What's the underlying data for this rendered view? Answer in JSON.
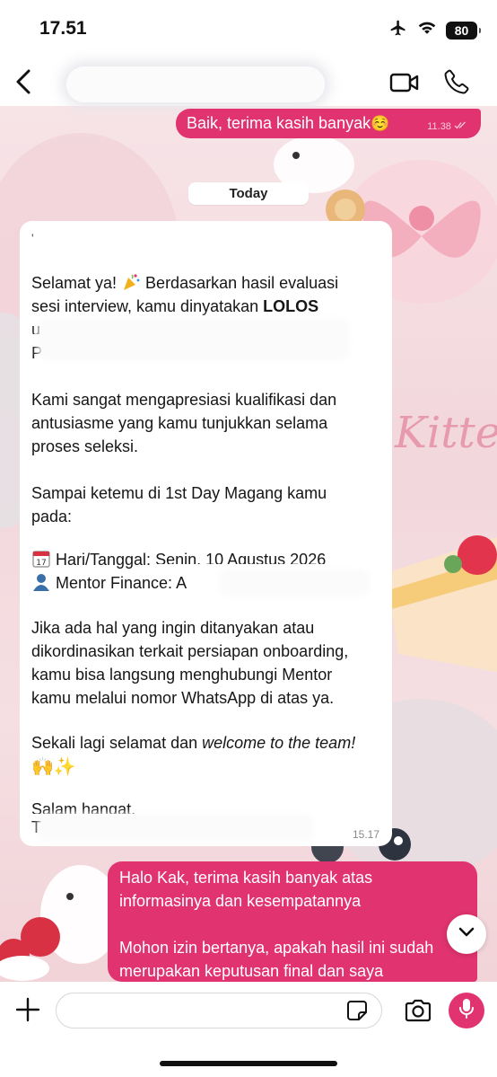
{
  "status_bar": {
    "time": "17.51",
    "battery": "80",
    "icons": [
      "airplane-icon",
      "wifi-icon",
      "battery-icon"
    ]
  },
  "header": {
    "icons": [
      "back-chevron-icon",
      "video-camera-icon",
      "phone-icon"
    ]
  },
  "messages": {
    "outgoing_top": {
      "text": "Baik, terima kasih banyak",
      "emoji": "☺️",
      "time": "11.38",
      "status": "read-ticks-icon"
    },
    "date_separator": "Today",
    "incoming": {
      "time": "15.17",
      "lines": {
        "l1a": "Selamat ya! ",
        "l1b": " Berdasarkan hasil evaluasi",
        "l2": "sesi interview, kamu dinyatakan ",
        "l2b": "LOLOS",
        "l3": "untuk bergabung sebagai Finance Intern di",
        "l4": "P",
        "l5": "Kami sangat mengapresiasi kualifikasi dan",
        "l6": "antusiasme yang kamu tunjukkan selama",
        "l7": "proses seleksi.",
        "l8": "Sampai ketemu di 1st Day Magang kamu",
        "l9": "pada:",
        "l10": " Hari/Tanggal: ",
        "l10b": "Senin, 10 Agustus 2026",
        "l11": " Mentor Finance: A",
        "l12": "Jika ada hal yang ingin ditanyakan atau",
        "l13": "dikordinasikan terkait persiapan onboarding,",
        "l14": "kamu bisa langsung menghubungi Mentor",
        "l15": "kamu melalui nomor WhatsApp di atas ya.",
        "l16": "Sekali lagi selamat dan ",
        "l16b": "welcome to the team!",
        "l17": "🙌✨",
        "l18": "Salam hangat,",
        "l19": "T"
      }
    },
    "outgoing_bottom": {
      "lines": [
        "Halo Kak, terima kasih banyak atas",
        "informasinya dan kesempatannya",
        "",
        "Mohon izin bertanya, apakah hasil ini sudah",
        "merupakan keputusan final dan saya"
      ]
    }
  },
  "input_bar": {
    "placeholder": "",
    "icons": [
      "plus-icon",
      "sticker-icon",
      "camera-icon",
      "microphone-icon"
    ]
  },
  "colors": {
    "accent": "#e0336f",
    "bubble_in": "#ffffff",
    "wallpaper": "#f4dfe4"
  }
}
